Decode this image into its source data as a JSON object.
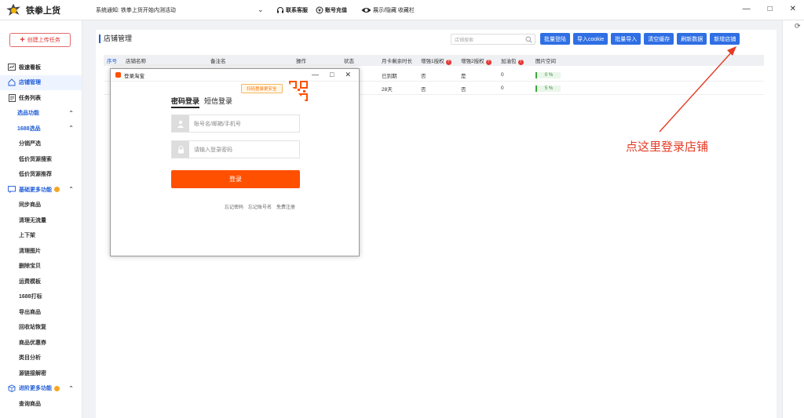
{
  "app": {
    "title": "铁拳上货"
  },
  "topbar": {
    "notice": "系统通知: 铁拳上货开始内测活动",
    "support": "联系客服",
    "recharge": "账号充值",
    "toggle_fav": "展示/隐藏 收藏栏"
  },
  "sidebar": {
    "create_task": "创建上传任务",
    "items": [
      {
        "label": "极速看板",
        "icon": "chart-icon"
      },
      {
        "label": "店铺管理",
        "icon": "home-icon"
      },
      {
        "label": "任务列表",
        "icon": "list-icon"
      }
    ],
    "group_select": "选品功能",
    "group_1688": "1688选品",
    "sub_1688": [
      "分销严选",
      "低价货源搜索",
      "低价货源推荐"
    ],
    "group_basic": "基础更多功能",
    "sub_basic": [
      "同步商品",
      "清理无流量",
      "上下架",
      "清理图片",
      "删除宝贝",
      "运费模板",
      "1688打标",
      "导出商品",
      "回收站恢复",
      "商品优惠券",
      "类目分析",
      "源链接解密"
    ],
    "group_advanced": "进阶更多功能",
    "sub_advanced": [
      "查询商品"
    ]
  },
  "main": {
    "title": "店铺管理",
    "search_placeholder": "店铺搜索",
    "buttons": [
      "批量登陆",
      "导入cookie",
      "批量导入",
      "清空缓存",
      "刷新数据",
      "新增店铺"
    ],
    "columns": [
      "序号",
      "店铺名称",
      "备注名",
      "操作",
      "状态",
      "月卡剩余时长",
      "增强1授权",
      "增强2授权",
      "加油包",
      "图片空间"
    ],
    "rows": [
      {
        "remaining": "已到期",
        "auth1": "否",
        "auth2": "是",
        "fuel": "0",
        "space": "0 %"
      },
      {
        "remaining": "28天",
        "auth1": "否",
        "auth2": "否",
        "fuel": "0",
        "space": "5 %"
      }
    ]
  },
  "annotation": {
    "text": "点这里登录店铺"
  },
  "dialog": {
    "title": "登录淘宝",
    "tab_password": "密码登录",
    "tab_sms": "短信登录",
    "qr_hint": "扫码登录更安全",
    "username_placeholder": "账号名/邮箱/手机号",
    "password_placeholder": "请输入登录密码",
    "login": "登录",
    "links": [
      "忘记密码",
      "忘记账号名",
      "免费注册"
    ]
  }
}
